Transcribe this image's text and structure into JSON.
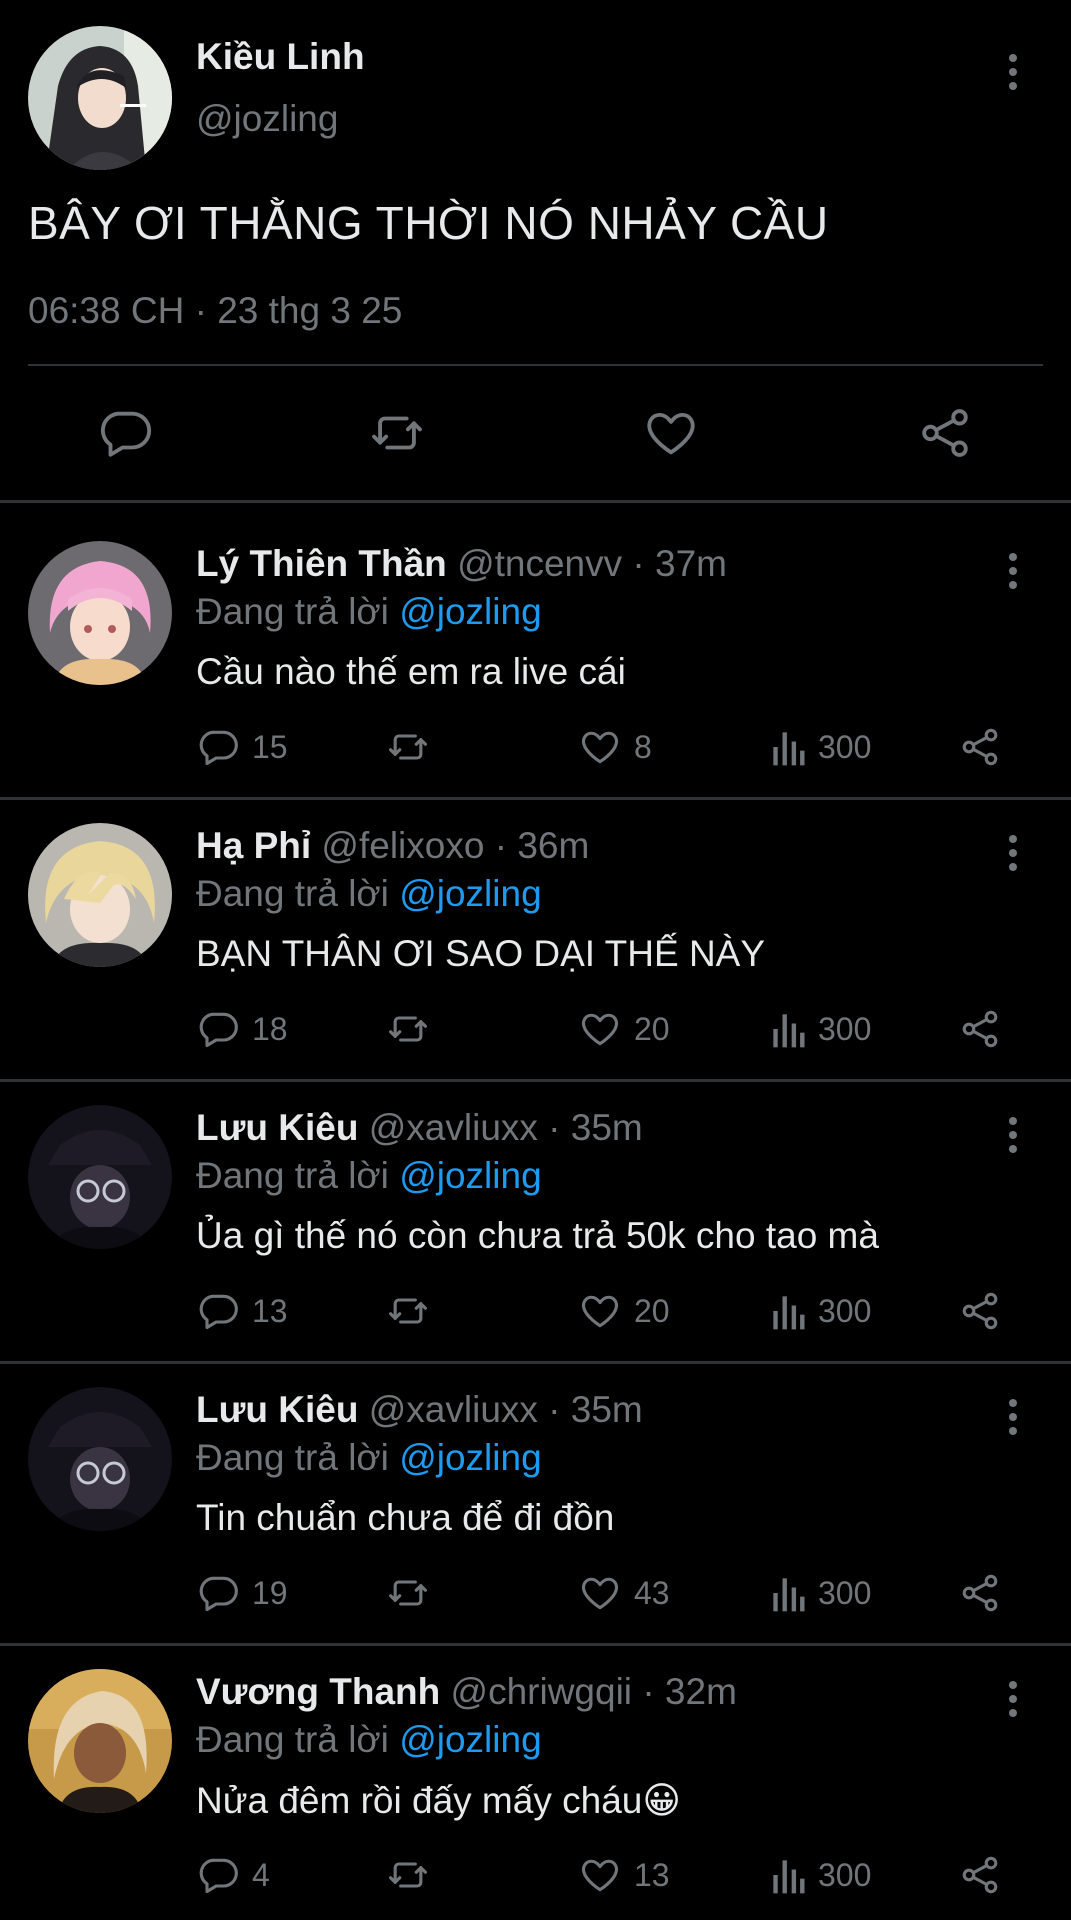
{
  "main": {
    "name": "Kiều Linh",
    "handle": "@jozling",
    "text": "BÂY ƠI THẰNG THỜI NÓ NHẢY CẦU",
    "time": "06:38 CH",
    "sep": "·",
    "date": "23 thg 3 25"
  },
  "icons": {
    "reply": "speech-bubble-icon",
    "retweet": "retweet-icon",
    "like": "heart-icon",
    "views": "bar-chart-icon",
    "share": "share-icon",
    "more": "vertical-dots-icon"
  },
  "colors": {
    "accent": "#1d9bf0",
    "muted": "#71767b",
    "text": "#e7e9ea",
    "background": "#000000"
  },
  "replies": [
    {
      "name": "Lý Thiên Thần",
      "handle": "@tncenvv",
      "sep": "·",
      "time": "37m",
      "replying": "Đang trả lời",
      "mention": "@jozling",
      "text": "Cầu nào thế em ra live cái",
      "replies": "15",
      "likes": "8",
      "views": "300"
    },
    {
      "name": "Hạ Phỉ",
      "handle": "@felixoxo",
      "sep": "·",
      "time": "36m",
      "replying": "Đang trả lời",
      "mention": "@jozling",
      "text": "BẠN THÂN ƠI SAO DẠI THẾ NÀY",
      "replies": "18",
      "likes": "20",
      "views": "300"
    },
    {
      "name": "Lưu Kiêu",
      "handle": "@xavliuxx",
      "sep": "·",
      "time": "35m",
      "replying": "Đang trả lời",
      "mention": "@jozling",
      "text": "Ủa gì thế nó còn chưa trả 50k cho tao mà",
      "replies": "13",
      "likes": "20",
      "views": "300"
    },
    {
      "name": "Lưu Kiêu",
      "handle": "@xavliuxx",
      "sep": "·",
      "time": "35m",
      "replying": "Đang trả lời",
      "mention": "@jozling",
      "text": "Tin chuẩn chưa để đi đồn",
      "replies": "19",
      "likes": "43",
      "views": "300"
    },
    {
      "name": "Vương Thanh",
      "handle": "@chriwgqii",
      "sep": "·",
      "time": "32m",
      "replying": "Đang trả lời",
      "mention": "@jozling",
      "text": "Nửa đêm rồi đấy mấy cháu",
      "emoji": "😀",
      "replies": "4",
      "likes": "13",
      "views": "300"
    }
  ]
}
